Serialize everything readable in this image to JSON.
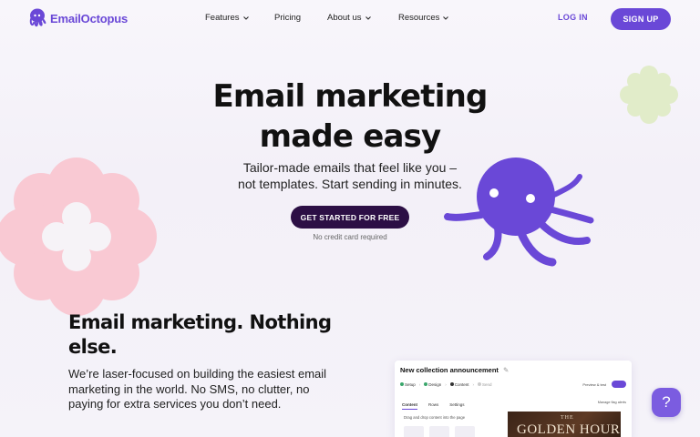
{
  "brand": {
    "name": "EmailOctopus",
    "accent": "#6a48d7",
    "cta_dark": "#2c0f45"
  },
  "nav": {
    "items": [
      {
        "label": "Features",
        "has_dropdown": true
      },
      {
        "label": "Pricing",
        "has_dropdown": false
      },
      {
        "label": "About us",
        "has_dropdown": true
      },
      {
        "label": "Resources",
        "has_dropdown": true
      }
    ],
    "login": "LOG IN",
    "signup": "SIGN UP"
  },
  "hero": {
    "title_line1": "Email marketing",
    "title_line2": "made easy",
    "subtitle_line1": "Tailor-made emails that feel like you –",
    "subtitle_line2": "not templates. Start sending in minutes.",
    "cta": "GET STARTED FOR FREE",
    "cta_note": "No credit card required"
  },
  "section": {
    "title": "Email marketing. Nothing else.",
    "body": "We’re laser-focused on building the easiest email marketing in the world. No SMS, no clutter, no paying for extra services you don’t need."
  },
  "preview": {
    "title": "New collection announcement",
    "steps": [
      "Setup",
      "Design",
      "Content",
      "Send"
    ],
    "tabs": [
      "Content",
      "Rows",
      "Settings"
    ],
    "hint": "Drag and drop content into the page",
    "side_note": "Manage flag alerts",
    "preview_btn": "Preview & test",
    "image_small": "THE",
    "image_big": "GOLDEN HOUR"
  },
  "help": {
    "label": "?"
  },
  "icons": [
    "octopus-logo-icon",
    "chevron-down-icon",
    "octopus-mascot-icon",
    "pink-flower-icon",
    "green-flower-icon",
    "help-icon"
  ]
}
